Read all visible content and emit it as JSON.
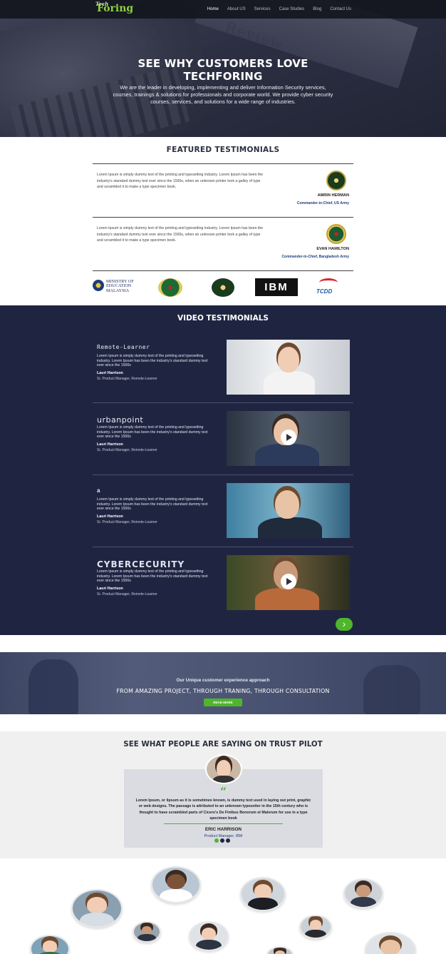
{
  "nav": {
    "logo_small": "Tech",
    "logo_main": "Foring",
    "links": [
      "Home",
      "About US",
      "Services",
      "Case Studies",
      "Blog",
      "Contact Us"
    ],
    "active": "Home"
  },
  "hero": {
    "stamp": "Review",
    "title_line1": "SEE WHY CUSTOMERS LOVE",
    "title_line2": "TECHFORING",
    "body": "We are the leader in developing, implementing and deliver Information Security services, courses, trainings & solutions for professionals and corporate world. We provide cyber security courses, services, and solutions for a wide range of industries."
  },
  "featured": {
    "title": "FEATURED TESTIMONIALS",
    "items": [
      {
        "text": "Lorem Ipsum is simply dummy text of the printing and typesetting industry. Lorem Ipsum has been the industry's standard dummy text ever since the 1500s, when an unknown printer took a galley of type and scrambled it to make a type specimen book.",
        "name": "AMRIN HERMAN",
        "role": "Commander-in-Chief, US Army"
      },
      {
        "text": "Lorem Ipsum is simply dummy text of the printing and typesetting industry. Lorem Ipsum has been the industry's standard dummy text ever since the 1500s, when an unknown printer took a galley of type and scrambled it to make a type specimen book.",
        "name": "EVAN HAMILTON",
        "role": "Commander-in-Chief, Bangladesh Army"
      }
    ],
    "logos": {
      "moe_line1": "MINISTRY OF",
      "moe_line2": "EDUCATION",
      "moe_line3": "MALAYSIA",
      "ibm": "IBM",
      "tcdd": "TCDD"
    }
  },
  "video": {
    "title": "VIDEO TESTIMONIALS",
    "items": [
      {
        "brand": "Remote-Learner",
        "text": "Lorem Ipsum is simply dummy text of the printing and typesetting industry. Lorem Ipsum has been the industry's standard dummy text ever since the 1500s",
        "name": "Lauri Harrison",
        "role": "Sr. Product Manager, Remote-Learner"
      },
      {
        "brand": "urbanpoint",
        "text": "Lorem Ipsum is simply dummy text of the printing and typesetting industry. Lorem Ipsum has been the industry's standard dummy text ever since the 1500s",
        "name": "Lauri Harrison",
        "role": "Sr. Product Manager, Remote-Learner"
      },
      {
        "brand": "a",
        "text": "Lorem Ipsum is simply dummy text of the printing and typesetting industry. Lorem Ipsum has been the industry's standard dummy text ever since the 1500s",
        "name": "Lauri Harrison",
        "role": "Sr. Product Manager, Remote-Learner"
      },
      {
        "brand": "CYBERCECURITY",
        "text": "Lorem Ipsum is simply dummy text of the printing and typesetting industry. Lorem Ipsum has been the industry's standard dummy text ever since the 1500s",
        "name": "Lauri Harrison",
        "role": "Sr. Product Manager, Remote-Learner"
      }
    ],
    "next_glyph": "›"
  },
  "cta": {
    "subtitle": "Our Unique customer experience approach",
    "title": "FROM AMAZING PROJECT, THROUGH TRANING, THROUGH CONSULTATION",
    "button": "READ MORE"
  },
  "trust": {
    "title": "SEE WHAT PEOPLE ARE SAYING ON TRUST PILOT",
    "quote_mark": "“",
    "text": "Lorem Ipsum, or lipsum as it is sometimes known, is dummy text used in laying out print, graphic or web designs. The passage is attributed to an unknown typesetter in the 15th century who is thought to have scrambled parts of Cicero's De Finibus Bonorum et Malorum for use in a type specimen book",
    "name": "ERIC HARRISON",
    "role": "Product Manager, IBM"
  },
  "colors": {
    "accent": "#4fb62c",
    "navy": "#1f2541"
  }
}
